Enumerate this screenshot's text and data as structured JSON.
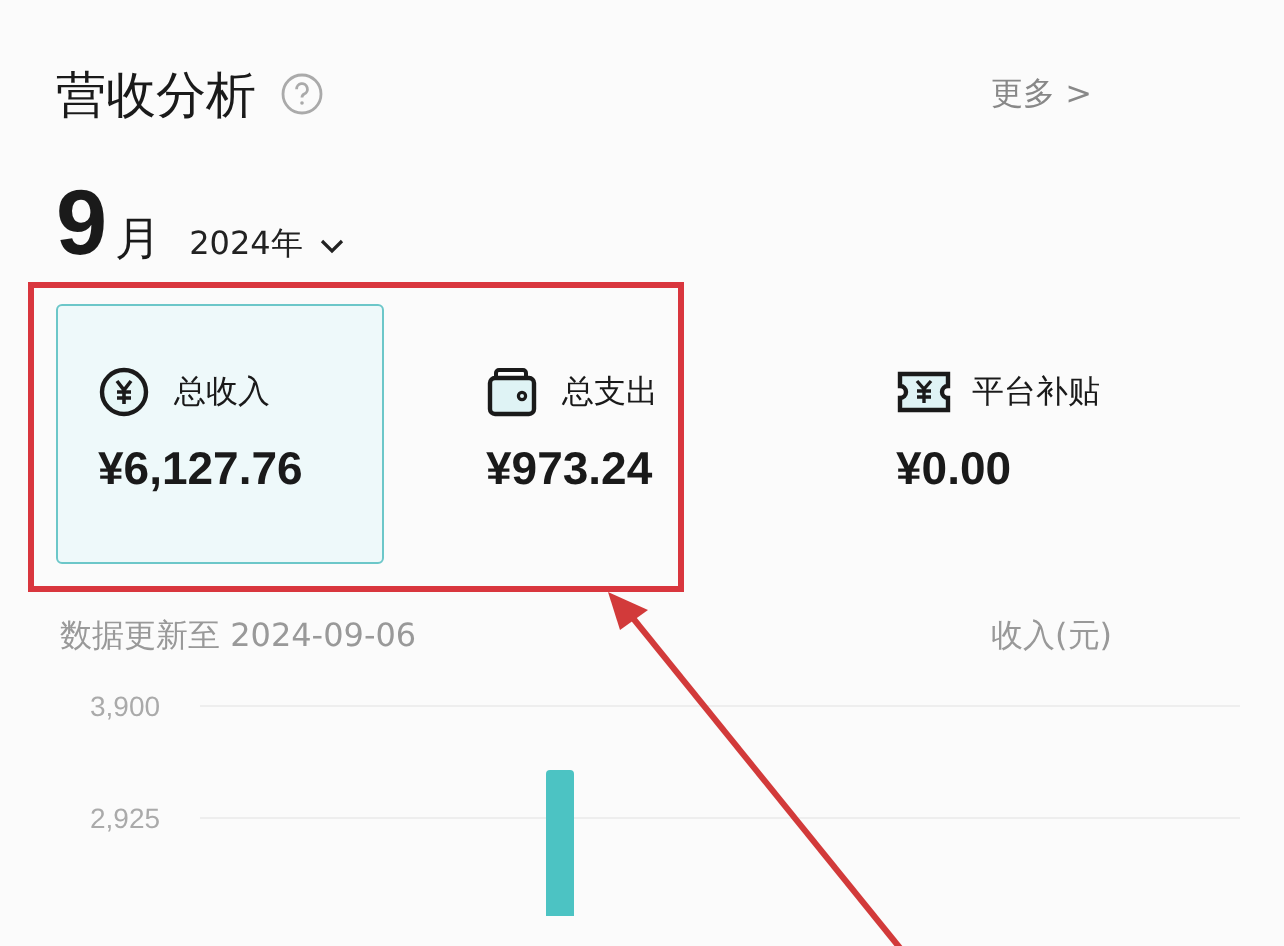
{
  "header": {
    "title": "营收分析",
    "more": "更多",
    "more_arrow": ">"
  },
  "period": {
    "month": "9",
    "month_unit": "月",
    "year": "2024年"
  },
  "summary": [
    {
      "kind": "income",
      "label": "总收入",
      "value": "¥6,127.76",
      "selected": true
    },
    {
      "kind": "expense",
      "label": "总支出",
      "value": "¥973.24",
      "selected": false
    },
    {
      "kind": "subsidy",
      "label": "平台补贴",
      "value": "¥0.00",
      "selected": false
    }
  ],
  "annotation": {
    "kind": "frame-arrow"
  },
  "update_note": "数据更新至 2024-09-06",
  "chart_unit": "收入(元)",
  "chart": {
    "axis_labels": [
      "3,900",
      "2,925"
    ]
  }
}
